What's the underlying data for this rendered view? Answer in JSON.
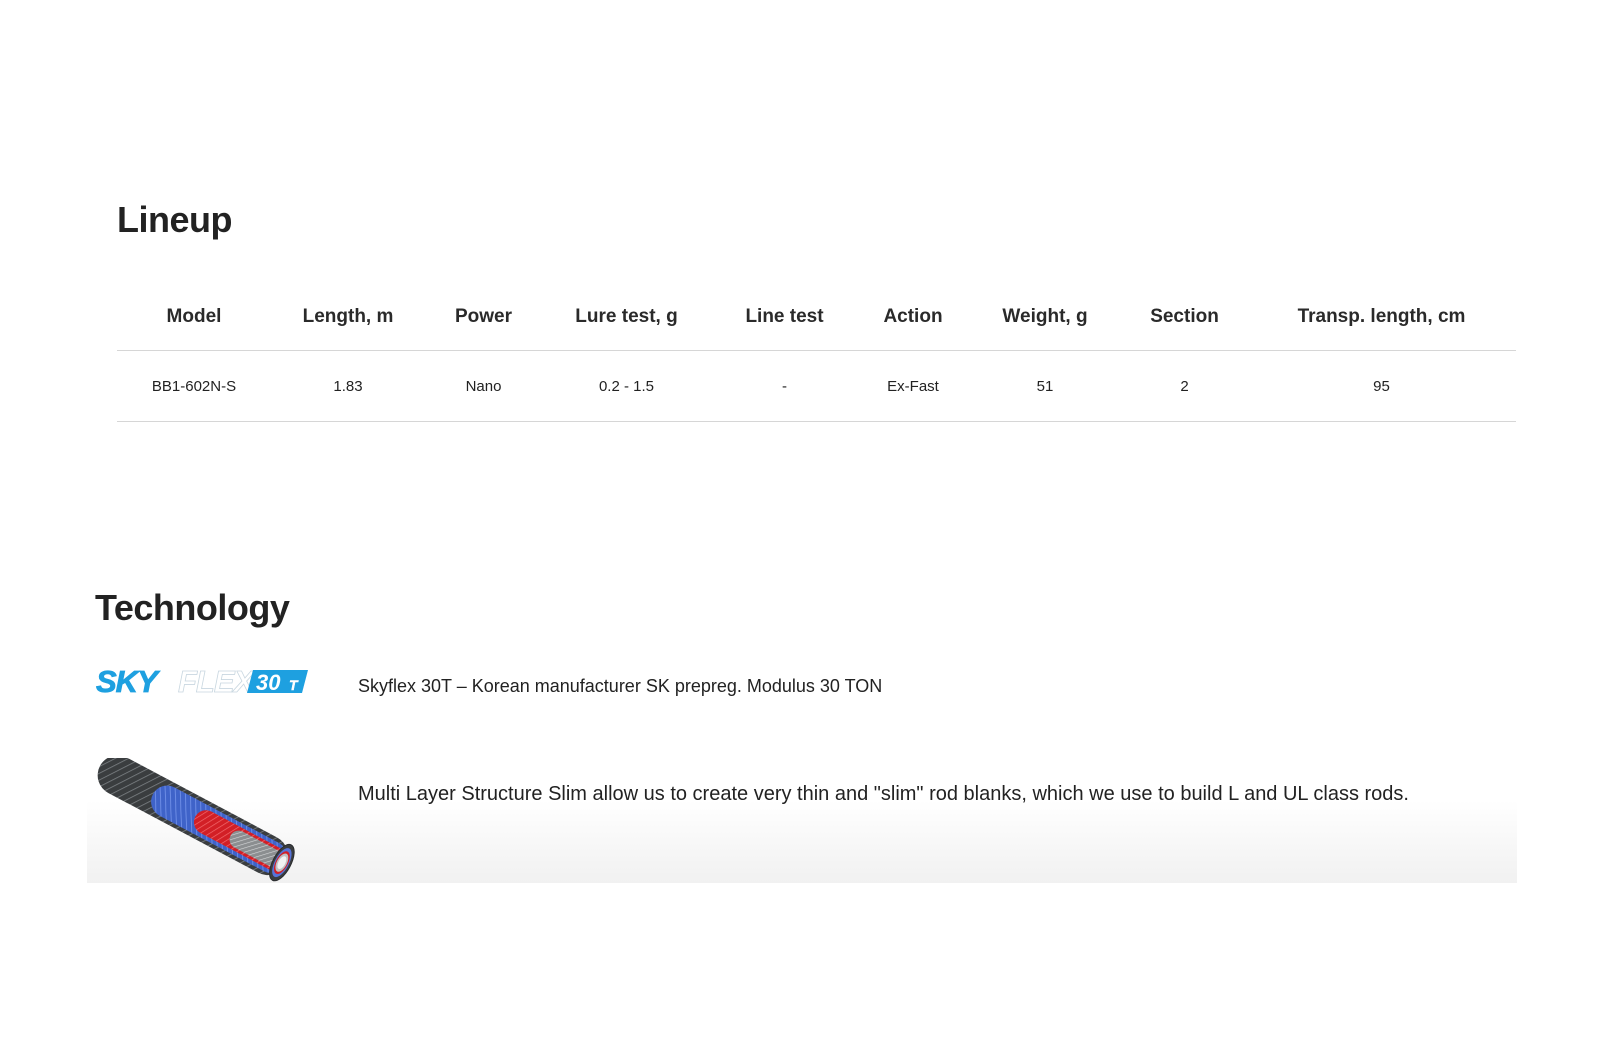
{
  "lineup": {
    "title": "Lineup",
    "columns": [
      "Model",
      "Length, m",
      "Power",
      "Lure test, g",
      "Line test",
      "Action",
      "Weight, g",
      "Section",
      "Transp. length, cm"
    ],
    "rows": [
      [
        "BB1-602N-S",
        "1.83",
        "Nano",
        "0.2 - 1.5",
        "-",
        "Ex-Fast",
        "51",
        "2",
        "95"
      ]
    ]
  },
  "technology": {
    "title": "Technology",
    "items": [
      {
        "logo_text": "SKYFLEX",
        "logo_badge": "30T",
        "logo_color": "#1ea0e0",
        "text": "Skyflex 30T – Korean manufacturer SK prepreg. Modulus 30 TON"
      },
      {
        "image": "multi-layer-rod-blank-cross-section",
        "text": "Multi Layer Structure Slim allow us to create very thin and \"slim\" rod blanks, which we use to build L and UL class rods."
      }
    ]
  }
}
